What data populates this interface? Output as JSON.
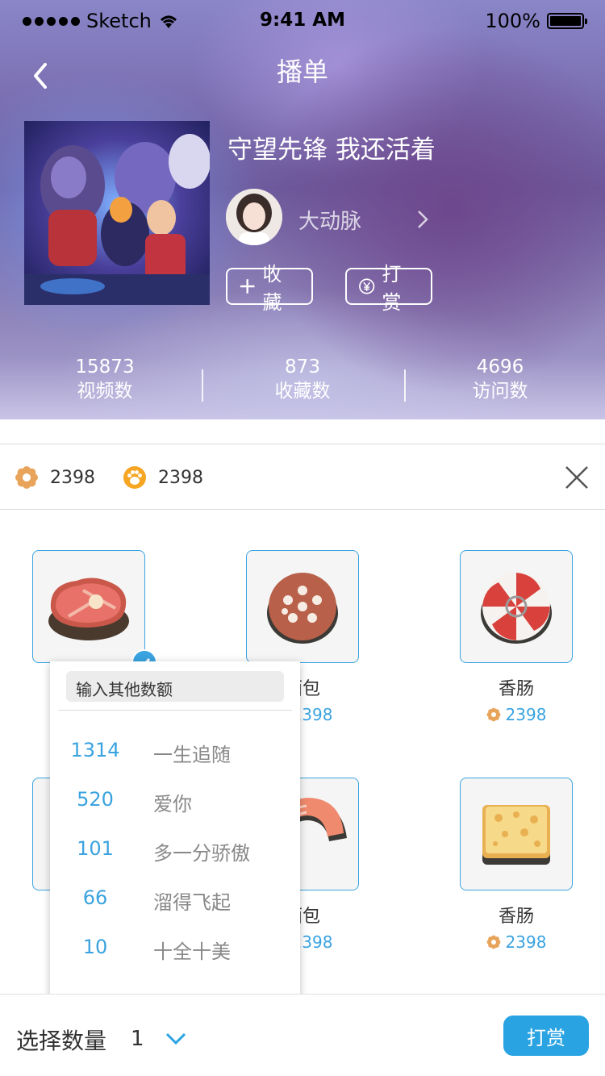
{
  "status_bar": {
    "carrier": "Sketch",
    "time": "9:41 AM",
    "battery": "100%"
  },
  "nav": {
    "title": "播单"
  },
  "playlist": {
    "title": "守望先锋 我还活着",
    "author": "大动脉",
    "favorite_label": "收藏",
    "tip_label": "打赏"
  },
  "stats": [
    {
      "value": "15873",
      "label": "视频数"
    },
    {
      "value": "873",
      "label": "收藏数"
    },
    {
      "value": "4696",
      "label": "访问数"
    }
  ],
  "balance": {
    "flower_count": "2398",
    "paw_count": "2398"
  },
  "gifts": [
    {
      "name": "",
      "price": "",
      "icon": "steak-icon",
      "selected": true
    },
    {
      "name": "面包",
      "price": "2398",
      "icon": "cookie-icon"
    },
    {
      "name": "香肠",
      "price": "2398",
      "icon": "candy-icon"
    },
    {
      "name": "",
      "price": "",
      "icon": "gift-icon"
    },
    {
      "name": "面包",
      "price": "2398",
      "icon": "salmon-icon"
    },
    {
      "name": "香肠",
      "price": "2398",
      "icon": "cheese-icon"
    }
  ],
  "amount_popover": {
    "input_placeholder": "输入其他数额",
    "options": [
      {
        "amount": "1314",
        "meaning": "一生追随"
      },
      {
        "amount": "520",
        "meaning": "爱你"
      },
      {
        "amount": "101",
        "meaning": "多一分骄傲"
      },
      {
        "amount": "66",
        "meaning": "溜得飞起"
      },
      {
        "amount": "10",
        "meaning": "十全十美"
      }
    ]
  },
  "bottom_bar": {
    "quantity_label": "选择数量",
    "quantity_value": "1",
    "submit_label": "打赏"
  },
  "colors": {
    "accent": "#2aa3e2",
    "price": "#3aa3e0",
    "flower": "#e8a45a"
  }
}
